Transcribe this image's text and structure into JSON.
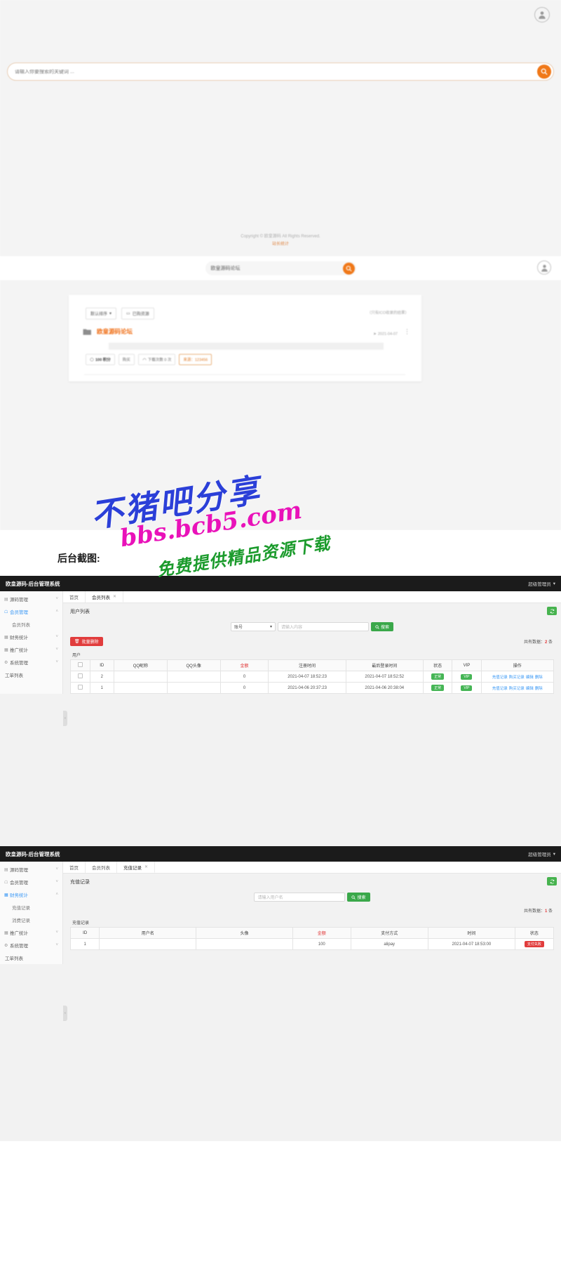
{
  "front_search": {
    "placeholder": "请输入你要搜索的关键词 ...",
    "search_icon": "search-icon",
    "avatar_icon": "user-icon",
    "copyright": "Copyright © 欧皇源码 All Rights Reserved.",
    "copyright_link": "站长统计"
  },
  "front_list": {
    "search_value": "欧皇源码论坛",
    "search_icon": "search-icon",
    "avatar_icon": "user-icon",
    "sort_button": "默认排序",
    "purchased_button": "已购资源",
    "right_note": "（只有ICO收录的结果）",
    "folder_icon": "folder-icon",
    "item_title": "欧皇源码论坛",
    "item_date": "2021-04-07",
    "more_icon": "more-vertical-icon",
    "tag_points": "100 积分",
    "tag_buy": "购买",
    "tag_downloads": "下载次数 0 次",
    "tag_source": "来源：123456"
  },
  "watermark": {
    "line1": "不猪吧分享",
    "line2": "bbs.bcb5.com",
    "line3": "免费提供精品资源下载"
  },
  "caption": {
    "text": "后台截图:"
  },
  "admin_members": {
    "logo": "欧皇源码-后台管理系统",
    "user_label": "超级管理员",
    "user_chevron": "chevron-down-icon",
    "sidebar": [
      {
        "label": "源码管理",
        "icon": "archive-icon",
        "chevron": "chevron-down-icon",
        "active": false,
        "sub": false
      },
      {
        "label": "会员管理",
        "icon": "user-icon",
        "chevron": "chevron-up-icon",
        "active": true,
        "sub": false
      },
      {
        "label": "会员列表",
        "icon": "",
        "chevron": "",
        "active": false,
        "sub": true
      },
      {
        "label": "财务统计",
        "icon": "chart-icon",
        "chevron": "chevron-down-icon",
        "active": false,
        "sub": false
      },
      {
        "label": "推广统计",
        "icon": "chart-icon",
        "chevron": "chevron-down-icon",
        "active": false,
        "sub": false
      },
      {
        "label": "系统管理",
        "icon": "gear-icon",
        "chevron": "chevron-down-icon",
        "active": false,
        "sub": false
      },
      {
        "label": "工单列表",
        "icon": "",
        "chevron": "",
        "active": false,
        "sub": false
      }
    ],
    "tabs": [
      {
        "label": "首页",
        "closable": false,
        "active": false
      },
      {
        "label": "会员列表",
        "closable": true,
        "active": true
      }
    ],
    "refresh_icon": "refresh-icon",
    "panel_title": "用户列表",
    "filter_select": "账号",
    "filter_select_chevron": "chevron-down-icon",
    "filter_placeholder": "请输入内容",
    "search_button": "搜索",
    "search_icon": "search-icon",
    "batch_delete_button": "批量删除",
    "trash_icon": "trash-icon",
    "total_label_prefix": "共有数据：",
    "total_count": "2",
    "total_label_suffix": "条",
    "group_label": "用户",
    "columns": [
      "",
      "ID",
      "QQ昵称",
      "QQ头像",
      "金额",
      "注册时间",
      "最后登录时间",
      "状态",
      "VIP",
      "操作"
    ],
    "rows": [
      {
        "id": "2",
        "nickname": "",
        "avatar": "",
        "amount": "0",
        "register_time": "2021-04-07 18:52:23",
        "last_login": "2021-04-07 18:52:52",
        "status": "正常",
        "vip": "VIP",
        "ops": [
          "充值记录",
          "购买记录",
          "编辑",
          "删除"
        ]
      },
      {
        "id": "1",
        "nickname": "",
        "avatar": "",
        "amount": "0",
        "register_time": "2021-04-06 20:37:23",
        "last_login": "2021-04-06 20:38:04",
        "status": "正常",
        "vip": "VIP",
        "ops": [
          "充值记录",
          "购买记录",
          "编辑",
          "删除"
        ]
      }
    ]
  },
  "admin_finance": {
    "logo": "欧皇源码-后台管理系统",
    "user_label": "超级管理员",
    "user_chevron": "chevron-down-icon",
    "sidebar": [
      {
        "label": "源码管理",
        "icon": "archive-icon",
        "chevron": "chevron-down-icon",
        "active": false,
        "sub": false
      },
      {
        "label": "会员管理",
        "icon": "user-icon",
        "chevron": "chevron-down-icon",
        "active": false,
        "sub": false
      },
      {
        "label": "财务统计",
        "icon": "chart-icon",
        "chevron": "chevron-up-icon",
        "active": true,
        "sub": false
      },
      {
        "label": "充值记录",
        "icon": "",
        "chevron": "",
        "active": false,
        "sub": true
      },
      {
        "label": "消费记录",
        "icon": "",
        "chevron": "",
        "active": false,
        "sub": true
      },
      {
        "label": "推广统计",
        "icon": "chart-icon",
        "chevron": "chevron-down-icon",
        "active": false,
        "sub": false
      },
      {
        "label": "系统管理",
        "icon": "gear-icon",
        "chevron": "chevron-down-icon",
        "active": false,
        "sub": false
      },
      {
        "label": "工单列表",
        "icon": "",
        "chevron": "",
        "active": false,
        "sub": false
      }
    ],
    "tabs": [
      {
        "label": "首页",
        "closable": false,
        "active": false
      },
      {
        "label": "会员列表",
        "closable": false,
        "active": false
      },
      {
        "label": "充值记录",
        "closable": true,
        "active": true
      }
    ],
    "refresh_icon": "refresh-icon",
    "panel_title": "充值记录",
    "filter_placeholder": "请输入用户名",
    "search_button": "搜索",
    "search_icon": "search-icon",
    "total_label_prefix": "共有数据：",
    "total_count": "1",
    "total_label_suffix": "条",
    "group_label": "充值记录",
    "columns": [
      "ID",
      "用户名",
      "头像",
      "金额",
      "支付方式",
      "时间",
      "状态"
    ],
    "rows": [
      {
        "id": "1",
        "username": "",
        "avatar": "",
        "amount": "100",
        "pay_method": "alipay",
        "time": "2021-04-07 18:53:00",
        "status": "支付失败"
      }
    ]
  },
  "colors": {
    "accent_orange": "#f07818",
    "link_blue": "#3a98f5",
    "green": "#45b555",
    "red": "#e13c3c",
    "dark_header": "#1b1b1b"
  }
}
